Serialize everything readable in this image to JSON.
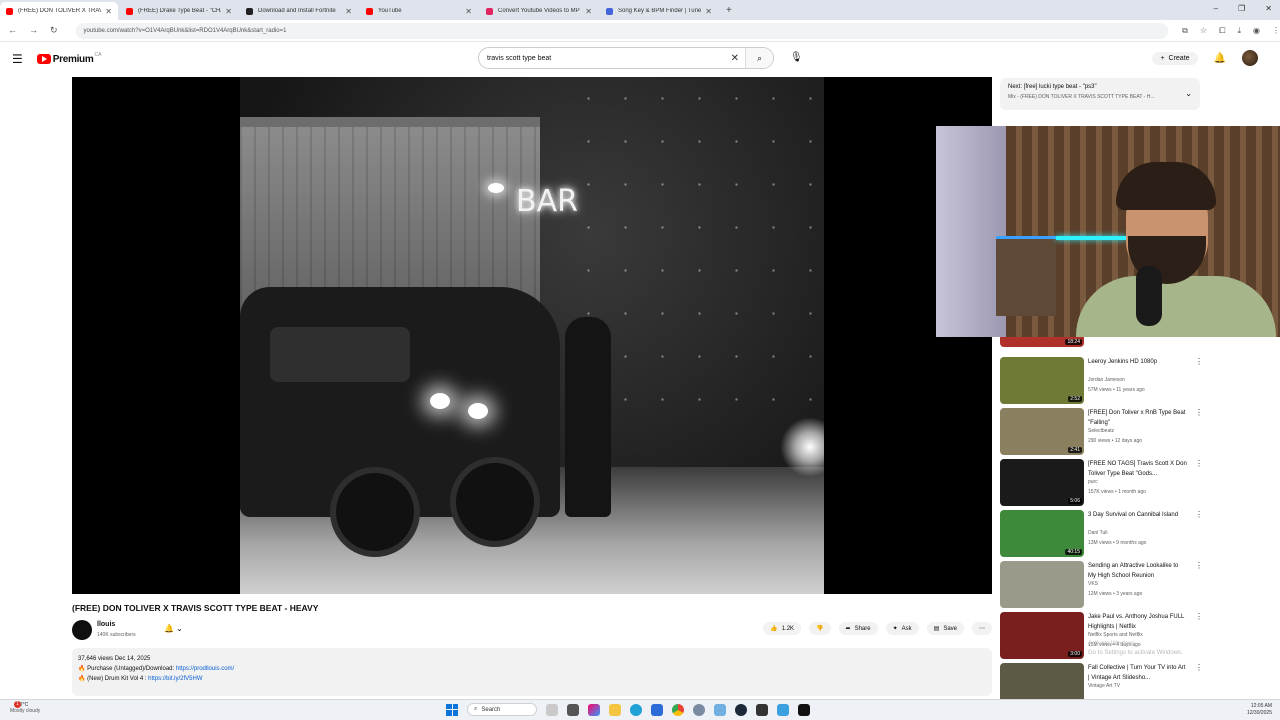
{
  "browser": {
    "tabs": [
      {
        "label": "(FREE) DON TOLIVER X TRAVIS",
        "color": "#ff0000",
        "active": true
      },
      {
        "label": "(FREE) Drake Type Beat - \"CHA",
        "color": "#ff0000",
        "active": false
      },
      {
        "label": "Download and Install Fortnite",
        "color": "#222222",
        "active": false
      },
      {
        "label": "YouTube",
        "color": "#ff0000",
        "active": false
      },
      {
        "label": "Convert Youtube Videos to MP",
        "color": "#e0245e",
        "active": false
      },
      {
        "label": "Song Key & BPM Finder | Tune",
        "color": "#4466dd",
        "active": false
      }
    ],
    "new_tab": "+",
    "address": "youtube.com/watch?v=O1V4ArqBUnk&list=RDO1V4ArqBUnk&start_radio=1"
  },
  "header": {
    "logo_text": "Premium",
    "logo_sup": "CA",
    "search_value": "travis scott type beat",
    "create_label": "Create"
  },
  "video": {
    "neon_sign": "BAR",
    "title": "(FREE) DON TOLIVER X TRAVIS SCOTT TYPE BEAT - HEAVY",
    "channel_name": "llouis",
    "channel_subs": "140K subscribers",
    "actions": {
      "likes": "1.2K",
      "share": "Share",
      "ask": "Ask",
      "save": "Save"
    },
    "description": {
      "stats": "37,646 views  Dec 14, 2025",
      "line1_prefix": "🔥 Purchase (Untagged)/Download: ",
      "line1_link": "https://prodllouis.com/",
      "line2_prefix": "🔥 (New) Drum Kit Vol 4 : ",
      "line2_link": "https://bit.ly/2fV5HW"
    }
  },
  "up_next": {
    "line1": "Next: [free] lucki type beat - \"ps3\"",
    "line2": "Mix - (FREE) DON TOLIVER X TRAVIS SCOTT TYPE BEAT - H..."
  },
  "recommendations": [
    {
      "title": "",
      "channel": "",
      "meta": "",
      "duration": "18:24",
      "thumb": "#b0302a"
    },
    {
      "title": "Leeroy Jenkins HD 1080p",
      "channel": "Jordan Jameson",
      "meta": "57M views • 11 years ago",
      "duration": "2:52",
      "thumb": "#6e7a35"
    },
    {
      "title": "[FREE] Don Toliver x RnB Type Beat \"Falling\"",
      "channel": "Selectbeatz",
      "meta": "290 views • 12 days ago",
      "duration": "2:41",
      "thumb": "#8a8060"
    },
    {
      "title": "[FREE NO TAGS] Travis Scott X Don Toliver Type Beat \"Gods...",
      "channel": "purc",
      "meta": "157K views • 1 month ago",
      "duration": "5:06",
      "thumb": "#1a1a1a"
    },
    {
      "title": "3 Day Survival on Cannibal Island",
      "channel": "Dani Tuli",
      "meta": "13M views • 9 months ago",
      "duration": "40:15",
      "thumb": "#3f8a3a"
    },
    {
      "title": "Sending an Attractive Lookalike to My High School Reunion",
      "channel": "VKS",
      "meta": "12M views • 3 years ago",
      "duration": "",
      "thumb": "#9a9a8a"
    },
    {
      "title": "Jake Paul vs. Anthony Joshua FULL Highlights | Netflix",
      "channel": "Netflix Sports and Netflix",
      "meta": "15M views • 4 days ago",
      "duration": "3:00",
      "thumb": "#7a1e1e"
    },
    {
      "title": "Fall Collective | Turn Your TV into Art | Vintage Art Slidesho...",
      "channel": "Vintage Art TV",
      "meta": "",
      "duration": "",
      "thumb": "#5c5a44"
    }
  ],
  "activate_windows": {
    "line1": "Activate Windows",
    "line2": "Go to Settings to activate Windows."
  },
  "taskbar": {
    "weather_temp": "7°C",
    "weather_desc": "Mostly cloudy",
    "weather_badge": "1",
    "search_label": "Search",
    "time": "12:05 AM",
    "date": "12/30/2025"
  }
}
